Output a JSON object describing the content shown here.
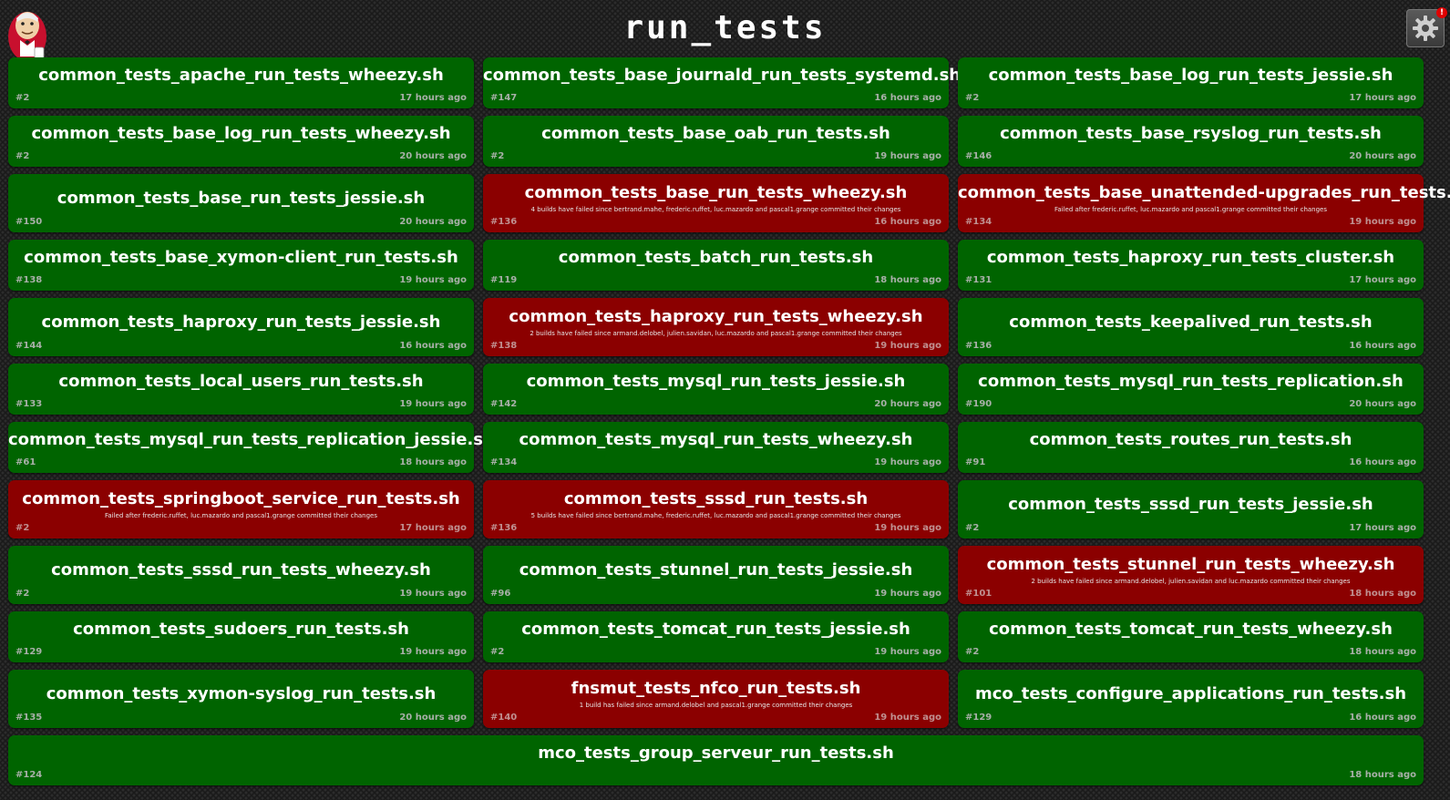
{
  "header": {
    "title": "run_tests",
    "settings_badge": "!"
  },
  "colors": {
    "success": "#006400",
    "failure": "#8b0000"
  },
  "jobs": [
    {
      "name": "common_tests_apache_run_tests_wheezy.sh",
      "number": "#2",
      "time": "17 hours ago",
      "status": "success",
      "culprits": ""
    },
    {
      "name": "common_tests_base_journald_run_tests_systemd.sh",
      "number": "#147",
      "time": "16 hours ago",
      "status": "success",
      "culprits": ""
    },
    {
      "name": "common_tests_base_log_run_tests_jessie.sh",
      "number": "#2",
      "time": "17 hours ago",
      "status": "success",
      "culprits": ""
    },
    {
      "name": "common_tests_base_log_run_tests_wheezy.sh",
      "number": "#2",
      "time": "20 hours ago",
      "status": "success",
      "culprits": ""
    },
    {
      "name": "common_tests_base_oab_run_tests.sh",
      "number": "#2",
      "time": "19 hours ago",
      "status": "success",
      "culprits": ""
    },
    {
      "name": "common_tests_base_rsyslog_run_tests.sh",
      "number": "#146",
      "time": "20 hours ago",
      "status": "success",
      "culprits": ""
    },
    {
      "name": "common_tests_base_run_tests_jessie.sh",
      "number": "#150",
      "time": "20 hours ago",
      "status": "success",
      "culprits": ""
    },
    {
      "name": "common_tests_base_run_tests_wheezy.sh",
      "number": "#136",
      "time": "16 hours ago",
      "status": "failure",
      "culprits": "4 builds have failed since bertrand.mahe, frederic.ruffet, luc.mazardo and pascal1.grange committed their changes"
    },
    {
      "name": "common_tests_base_unattended-upgrades_run_tests.sh",
      "number": "#134",
      "time": "19 hours ago",
      "status": "failure",
      "culprits": "Failed after frederic.ruffet, luc.mazardo and pascal1.grange committed their changes"
    },
    {
      "name": "common_tests_base_xymon-client_run_tests.sh",
      "number": "#138",
      "time": "19 hours ago",
      "status": "success",
      "culprits": ""
    },
    {
      "name": "common_tests_batch_run_tests.sh",
      "number": "#119",
      "time": "18 hours ago",
      "status": "success",
      "culprits": ""
    },
    {
      "name": "common_tests_haproxy_run_tests_cluster.sh",
      "number": "#131",
      "time": "17 hours ago",
      "status": "success",
      "culprits": ""
    },
    {
      "name": "common_tests_haproxy_run_tests_jessie.sh",
      "number": "#144",
      "time": "16 hours ago",
      "status": "success",
      "culprits": ""
    },
    {
      "name": "common_tests_haproxy_run_tests_wheezy.sh",
      "number": "#138",
      "time": "19 hours ago",
      "status": "failure",
      "culprits": "2 builds have failed since armand.delobel, julien.savidan, luc.mazardo and pascal1.grange committed their changes"
    },
    {
      "name": "common_tests_keepalived_run_tests.sh",
      "number": "#136",
      "time": "16 hours ago",
      "status": "success",
      "culprits": ""
    },
    {
      "name": "common_tests_local_users_run_tests.sh",
      "number": "#133",
      "time": "19 hours ago",
      "status": "success",
      "culprits": ""
    },
    {
      "name": "common_tests_mysql_run_tests_jessie.sh",
      "number": "#142",
      "time": "20 hours ago",
      "status": "success",
      "culprits": ""
    },
    {
      "name": "common_tests_mysql_run_tests_replication.sh",
      "number": "#190",
      "time": "20 hours ago",
      "status": "success",
      "culprits": ""
    },
    {
      "name": "common_tests_mysql_run_tests_replication_jessie.sh",
      "number": "#61",
      "time": "18 hours ago",
      "status": "success",
      "culprits": ""
    },
    {
      "name": "common_tests_mysql_run_tests_wheezy.sh",
      "number": "#134",
      "time": "19 hours ago",
      "status": "success",
      "culprits": ""
    },
    {
      "name": "common_tests_routes_run_tests.sh",
      "number": "#91",
      "time": "16 hours ago",
      "status": "success",
      "culprits": ""
    },
    {
      "name": "common_tests_springboot_service_run_tests.sh",
      "number": "#2",
      "time": "17 hours ago",
      "status": "failure",
      "culprits": "Failed after frederic.ruffet, luc.mazardo and pascal1.grange committed their changes"
    },
    {
      "name": "common_tests_sssd_run_tests.sh",
      "number": "#136",
      "time": "19 hours ago",
      "status": "failure",
      "culprits": "5 builds have failed since bertrand.mahe, frederic.ruffet, luc.mazardo and pascal1.grange committed their changes"
    },
    {
      "name": "common_tests_sssd_run_tests_jessie.sh",
      "number": "#2",
      "time": "17 hours ago",
      "status": "success",
      "culprits": ""
    },
    {
      "name": "common_tests_sssd_run_tests_wheezy.sh",
      "number": "#2",
      "time": "19 hours ago",
      "status": "success",
      "culprits": ""
    },
    {
      "name": "common_tests_stunnel_run_tests_jessie.sh",
      "number": "#96",
      "time": "19 hours ago",
      "status": "success",
      "culprits": ""
    },
    {
      "name": "common_tests_stunnel_run_tests_wheezy.sh",
      "number": "#101",
      "time": "18 hours ago",
      "status": "failure",
      "culprits": "2 builds have failed since armand.delobel, julien.savidan and luc.mazardo committed their changes"
    },
    {
      "name": "common_tests_sudoers_run_tests.sh",
      "number": "#129",
      "time": "19 hours ago",
      "status": "success",
      "culprits": ""
    },
    {
      "name": "common_tests_tomcat_run_tests_jessie.sh",
      "number": "#2",
      "time": "19 hours ago",
      "status": "success",
      "culprits": ""
    },
    {
      "name": "common_tests_tomcat_run_tests_wheezy.sh",
      "number": "#2",
      "time": "18 hours ago",
      "status": "success",
      "culprits": ""
    },
    {
      "name": "common_tests_xymon-syslog_run_tests.sh",
      "number": "#135",
      "time": "20 hours ago",
      "status": "success",
      "culprits": ""
    },
    {
      "name": "fnsmut_tests_nfco_run_tests.sh",
      "number": "#140",
      "time": "19 hours ago",
      "status": "failure",
      "culprits": "1 build has failed since armand.delobel and pascal1.grange committed their changes"
    },
    {
      "name": "mco_tests_configure_applications_run_tests.sh",
      "number": "#129",
      "time": "16 hours ago",
      "status": "success",
      "culprits": ""
    },
    {
      "name": "mco_tests_group_serveur_run_tests.sh",
      "number": "#124",
      "time": "18 hours ago",
      "status": "success",
      "culprits": ""
    }
  ]
}
